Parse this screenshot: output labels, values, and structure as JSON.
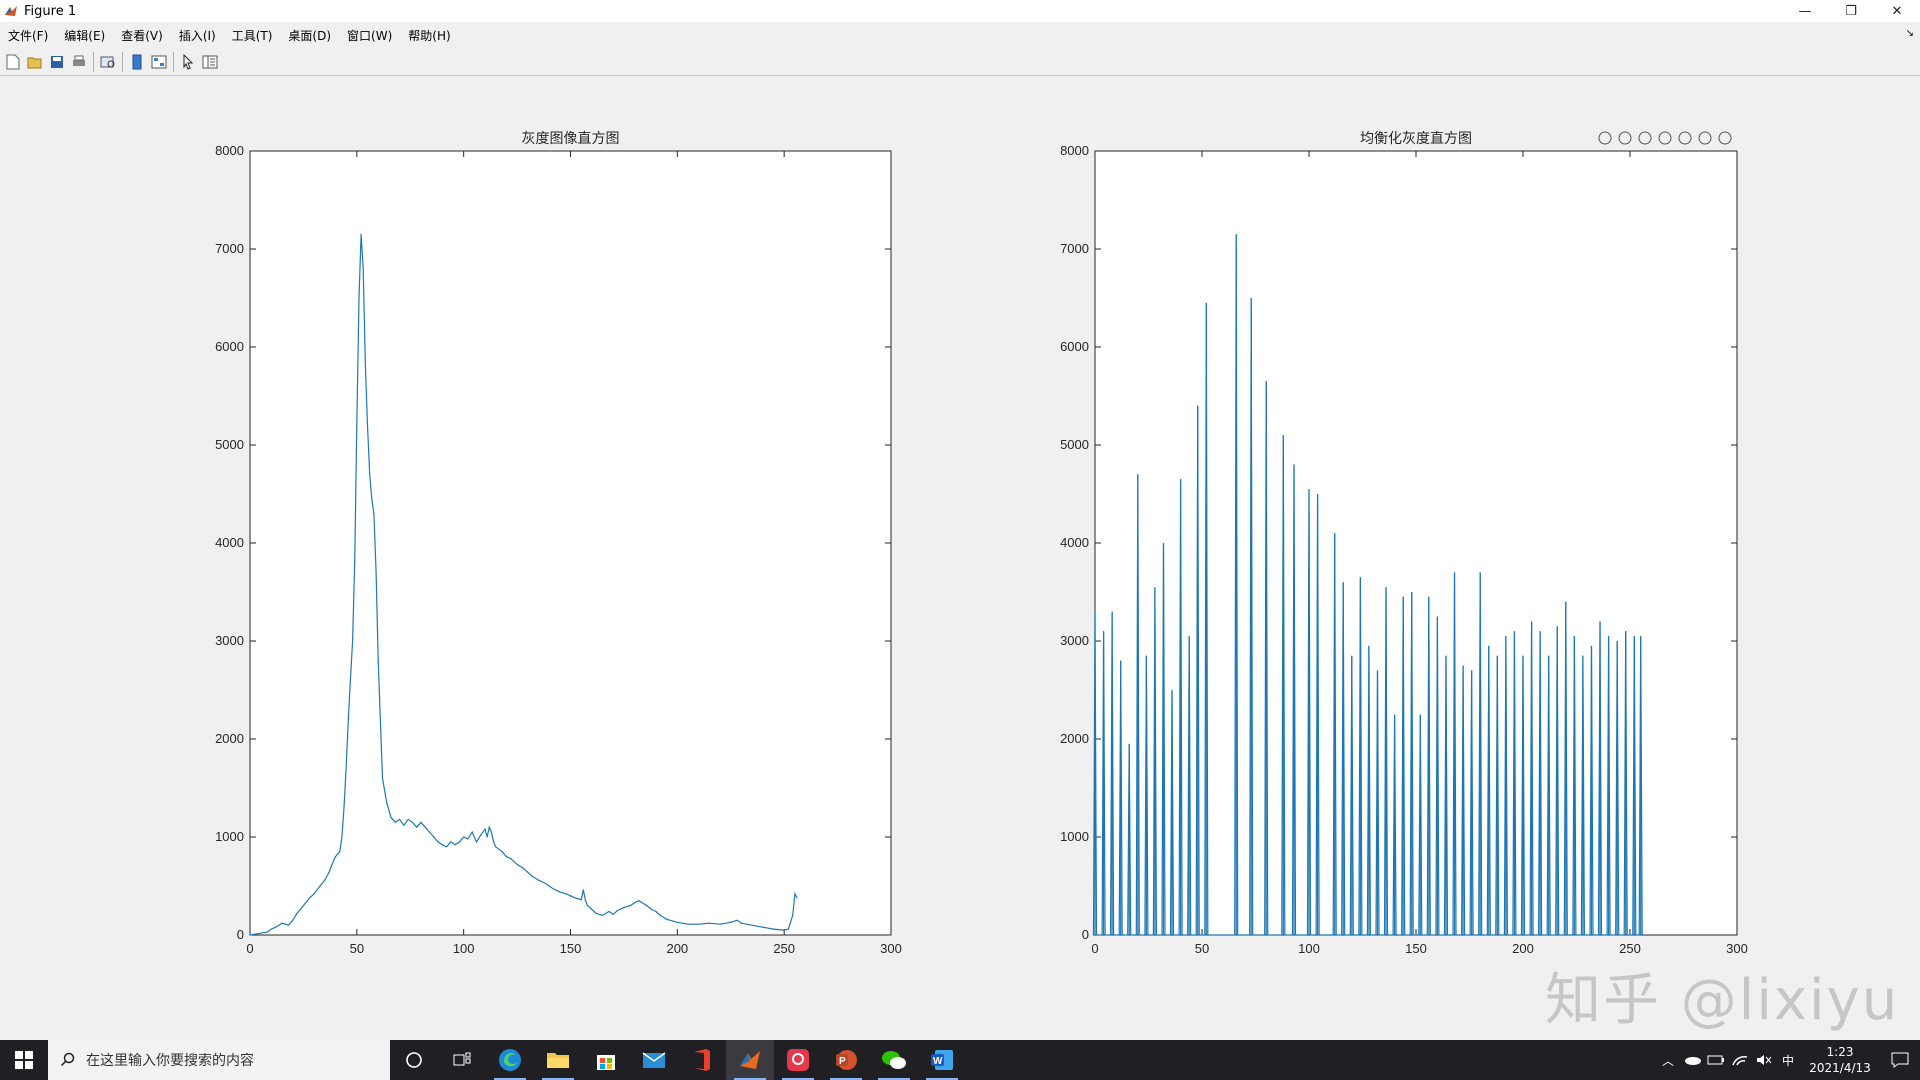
{
  "window": {
    "title": "Figure 1",
    "minimize": "—",
    "restore": "❐",
    "close": "✕"
  },
  "menu": [
    "文件(F)",
    "编辑(E)",
    "查看(V)",
    "插入(I)",
    "工具(T)",
    "桌面(D)",
    "窗口(W)",
    "帮助(H)"
  ],
  "toolbar": [
    "new-figure-icon",
    "open-file-icon",
    "save-icon",
    "print-icon",
    "print-preview-icon",
    "link-plot-icon",
    "property-inspector-icon",
    "edit-plot-icon",
    "plot-browser-icon"
  ],
  "axes_toolbar": [
    "export-icon",
    "brush-icon",
    "datatip-icon",
    "pan-icon",
    "zoom-in-icon",
    "zoom-out-icon",
    "home-icon"
  ],
  "colors": {
    "line": "#1f77b4",
    "figure_bg": "#f0f0f0",
    "axes_bg": "#ffffff",
    "taskbar": "#202024"
  },
  "chart_data": [
    {
      "type": "line",
      "title": "灰度图像直方图",
      "xlabel": "",
      "ylabel": "",
      "xlim": [
        0,
        300
      ],
      "ylim": [
        0,
        8000
      ],
      "xticks": [
        "0",
        "50",
        "100",
        "150",
        "200",
        "250",
        "300"
      ],
      "yticks": [
        "0",
        "1000",
        "2000",
        "3000",
        "4000",
        "5000",
        "6000",
        "7000",
        "8000"
      ],
      "x": [
        0,
        8,
        10,
        12,
        15,
        18,
        20,
        22,
        25,
        28,
        30,
        32,
        35,
        37,
        38,
        40,
        42,
        43,
        44,
        45,
        46,
        47,
        48,
        49,
        50,
        51,
        52,
        53,
        54,
        55,
        56,
        57,
        58,
        59,
        60,
        62,
        64,
        66,
        68,
        70,
        72,
        74,
        76,
        78,
        80,
        82,
        84,
        86,
        88,
        90,
        92,
        94,
        96,
        98,
        100,
        102,
        104,
        106,
        108,
        110,
        111,
        112,
        113,
        114,
        115,
        118,
        120,
        122,
        125,
        128,
        130,
        132,
        135,
        138,
        140,
        142,
        145,
        148,
        150,
        152,
        155,
        156,
        157,
        158,
        160,
        162,
        165,
        168,
        170,
        172,
        175,
        178,
        180,
        182,
        185,
        188,
        190,
        192,
        195,
        200,
        205,
        210,
        215,
        220,
        225,
        228,
        230,
        235,
        240,
        245,
        250,
        252,
        254,
        255,
        256
      ],
      "y": [
        0,
        30,
        60,
        80,
        120,
        100,
        150,
        220,
        300,
        380,
        420,
        480,
        560,
        640,
        700,
        800,
        850,
        1000,
        1300,
        1700,
        2200,
        2600,
        3000,
        3800,
        5200,
        6500,
        7150,
        6800,
        5800,
        5200,
        4700,
        4450,
        4300,
        3700,
        2800,
        1600,
        1350,
        1200,
        1150,
        1180,
        1120,
        1180,
        1150,
        1100,
        1150,
        1100,
        1050,
        1000,
        950,
        920,
        900,
        950,
        920,
        950,
        1000,
        980,
        1050,
        950,
        1020,
        1080,
        1000,
        1100,
        1050,
        950,
        900,
        850,
        800,
        780,
        720,
        680,
        640,
        600,
        560,
        530,
        500,
        470,
        440,
        420,
        400,
        380,
        360,
        460,
        350,
        300,
        260,
        220,
        200,
        240,
        210,
        250,
        280,
        300,
        330,
        350,
        310,
        260,
        240,
        200,
        160,
        130,
        110,
        110,
        120,
        110,
        130,
        150,
        120,
        100,
        80,
        60,
        50,
        60,
        200,
        420,
        380
      ]
    },
    {
      "type": "stem",
      "title": "均衡化灰度直方图",
      "xlabel": "",
      "ylabel": "",
      "xlim": [
        0,
        300
      ],
      "ylim": [
        0,
        8000
      ],
      "xticks": [
        "0",
        "50",
        "100",
        "150",
        "200",
        "250",
        "300"
      ],
      "yticks": [
        "0",
        "1000",
        "2000",
        "3000",
        "4000",
        "5000",
        "6000",
        "7000",
        "8000"
      ],
      "x": [
        0,
        4,
        8,
        12,
        16,
        20,
        24,
        28,
        32,
        36,
        40,
        44,
        48,
        52,
        66,
        73,
        80,
        88,
        93,
        100,
        104,
        112,
        116,
        120,
        124,
        128,
        132,
        136,
        140,
        144,
        148,
        152,
        156,
        160,
        164,
        168,
        172,
        176,
        180,
        184,
        188,
        192,
        196,
        200,
        204,
        208,
        212,
        216,
        220,
        224,
        228,
        232,
        236,
        240,
        244,
        248,
        252,
        255
      ],
      "y": [
        3300,
        3100,
        3300,
        2800,
        1950,
        4700,
        2850,
        3550,
        4000,
        2500,
        4650,
        3050,
        5400,
        6450,
        7150,
        6500,
        5650,
        5100,
        4800,
        4550,
        4500,
        4100,
        3600,
        2850,
        3650,
        2950,
        2700,
        3550,
        2250,
        3450,
        3500,
        2250,
        3450,
        3250,
        2850,
        3700,
        2750,
        2700,
        3700,
        2950,
        2850,
        3050,
        3100,
        2850,
        3200,
        3100,
        2850,
        3150,
        3400,
        3050,
        2850,
        2950,
        3200,
        3050,
        3000,
        3100,
        3050,
        3050
      ]
    }
  ],
  "watermark": "知乎 @lixiyu",
  "taskbar": {
    "search_placeholder": "在这里输入你要搜索的内容",
    "apps": [
      "cortana-icon",
      "task-view-icon",
      "edge-icon",
      "file-explorer-icon",
      "store-icon",
      "mail-icon",
      "office-icon",
      "matlab-icon",
      "pdf-icon",
      "powerpoint-icon",
      "wechat-icon",
      "word-icon"
    ],
    "ime": "中",
    "time": "1:23",
    "date": "2021/4/13"
  }
}
